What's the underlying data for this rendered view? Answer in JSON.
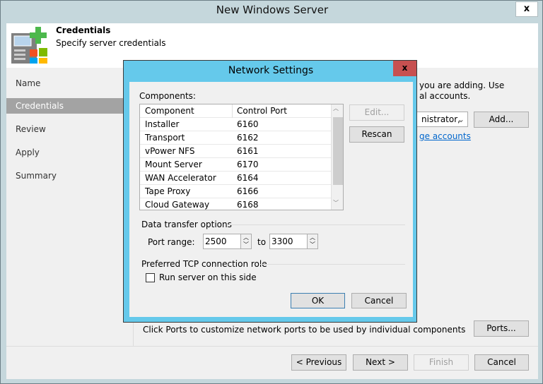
{
  "window": {
    "title": "New Windows Server",
    "close": "x"
  },
  "header": {
    "title": "Credentials",
    "subtitle": "Specify server credentials"
  },
  "nav": [
    "Name",
    "Credentials",
    "Review",
    "Apply",
    "Summary"
  ],
  "main": {
    "desc_line1": "you are adding. Use",
    "desc_line2": "al accounts.",
    "account_value": "nistrator,",
    "add_label": "Add...",
    "manage_link": "ge accounts",
    "ports_hint": "Click Ports to customize network ports to be used by individual components",
    "ports_label": "Ports..."
  },
  "footer": {
    "previous": "< Previous",
    "next": "Next >",
    "finish": "Finish",
    "cancel": "Cancel"
  },
  "dialog": {
    "title": "Network Settings",
    "close": "x",
    "components_label": "Components:",
    "columns": [
      "Component",
      "Control Port"
    ],
    "rows": [
      [
        "Installer",
        "6160"
      ],
      [
        "Transport",
        "6162"
      ],
      [
        "vPower NFS",
        "6161"
      ],
      [
        "Mount Server",
        "6170"
      ],
      [
        "WAN Accelerator",
        "6164"
      ],
      [
        "Tape Proxy",
        "6166"
      ],
      [
        "Cloud Gateway",
        "6168"
      ]
    ],
    "edit": "Edit...",
    "rescan": "Rescan",
    "data_transfer_label": "Data transfer options",
    "port_range_label": "Port range:",
    "port_from": "2500",
    "to_label": "to",
    "port_to": "3300",
    "tcp_role_label": "Preferred TCP connection role",
    "run_server_label": "Run server on this side",
    "run_server_checked": false,
    "ok": "OK",
    "cancel": "Cancel"
  }
}
